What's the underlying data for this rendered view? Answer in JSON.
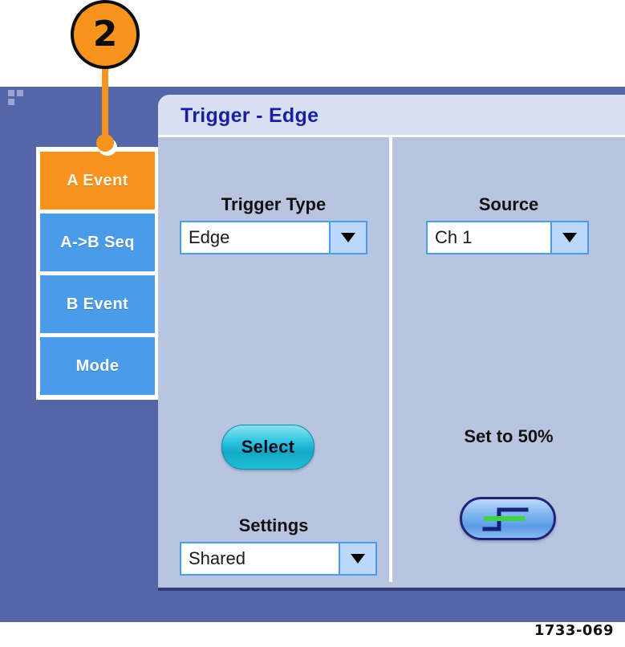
{
  "callout": {
    "number": "2"
  },
  "sidebar": {
    "items": [
      {
        "label": "A Event",
        "state": "selected"
      },
      {
        "label": "A->B Seq",
        "state": "normal"
      },
      {
        "label": "B Event",
        "state": "normal"
      },
      {
        "label": "Mode",
        "state": "normal"
      }
    ]
  },
  "dialog": {
    "title": "Trigger - Edge",
    "left_column": {
      "trigger_type": {
        "label": "Trigger Type",
        "value": "Edge",
        "arrow_icon": "chevron-down-icon"
      },
      "select_button": {
        "label": "Select"
      },
      "settings": {
        "label": "Settings",
        "value": "Shared",
        "arrow_icon": "chevron-down-icon"
      }
    },
    "right_column": {
      "source": {
        "label": "Source",
        "value": "Ch 1",
        "arrow_icon": "chevron-down-icon"
      },
      "set_to_50": {
        "label": "Set to 50%",
        "button_icon": "rising-edge-trigger-level-icon"
      }
    }
  },
  "figure": {
    "caption": "1733-069"
  },
  "colors": {
    "accent_orange": "#f7941e",
    "tab_blue": "#4a9be8",
    "app_background": "#5566a8",
    "dialog_body": "#b9c5e0",
    "titlebar": "#d8dff0",
    "title_text": "#1a1f9e",
    "select_button": "#2ec4de",
    "trigger_level_green": "#3fd43f"
  }
}
